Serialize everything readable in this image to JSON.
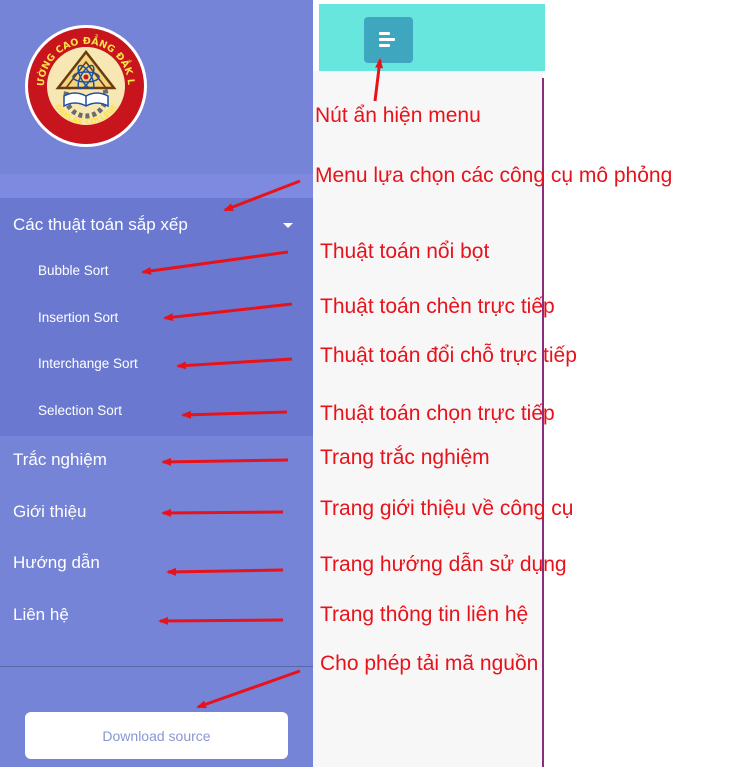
{
  "logo": {
    "ring_text": "TRƯỜNG CAO ĐẲNG ĐẮK LẮK",
    "bottom_text": "DAKLAK COLLEGE"
  },
  "sidebar": {
    "group_label": "Các thuật toán sắp xếp",
    "sub_items": [
      "Bubble Sort",
      "Insertion Sort",
      "Interchange Sort",
      "Selection Sort"
    ],
    "nav_items": [
      "Trắc nghiệm",
      "Giới thiệu",
      "Hướng dẫn",
      "Liên hệ"
    ],
    "download_label": "Download source"
  },
  "annotations": {
    "toggle": "Nút ẩn hiện menu",
    "menu": "Menu lựa chọn các công cụ mô phỏng",
    "bubble": "Thuật toán nổi bọt",
    "insertion": "Thuật toán chèn trực tiếp",
    "interchange": "Thuật toán đổi chỗ trực tiếp",
    "selection": "Thuật toán chọn trực tiếp",
    "quiz": "Trang trắc nghiệm",
    "about": "Trang giới thiệu về công cụ",
    "guide": "Trang hướng dẫn sử dụng",
    "contact": "Trang thông tin liên hệ",
    "download": "Cho phép tải mã nguồn"
  },
  "colors": {
    "sidebar": "#7684d8",
    "submenu": "#6a79cf",
    "topbar": "#67e6dd",
    "toggle": "#3ea7bf",
    "annotation": "#e8121b"
  },
  "icons": {
    "toggle": "align-left-icon",
    "caret": "caret-down-icon",
    "logo": "college-logo"
  }
}
